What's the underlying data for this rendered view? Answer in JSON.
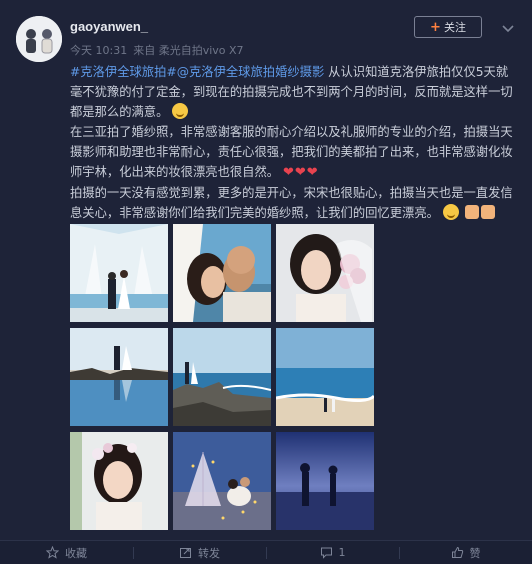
{
  "header": {
    "username": "gaoyanwen_",
    "time": "今天 10:31",
    "source": "来自 柔光自拍vivo X7",
    "follow_label": "关注"
  },
  "post": {
    "topic1": "#克洛伊全球旅拍#",
    "topic2": "@克洛伊全球旅拍婚纱摄影",
    "line1": " 从认识知道克洛伊旅拍仅仅5天就毫不犹豫的付了定金，到现在的拍摄完成也不到两个月的时间，反而就是这样一切都是那么的满意。",
    "line2": "在三亚拍了婚纱照，非常感谢客服的耐心介绍以及礼服师的专业的介绍，拍摄当天摄影师和助理也非常耐心，责任心很强，把我们的美都拍了出来，也非常感谢化妆师宇林，化出来的妆很漂亮也很自然。",
    "hearts": "❤❤❤",
    "line3": "拍摄的一天没有感觉到累，更多的是开心，宋宋也很贴心，拍摄当天也是一直发信息关心，非常感谢你们给我们完美的婚纱照，让我们的回忆更漂亮。"
  },
  "photos": [
    {
      "name": "photo-chapel-couple"
    },
    {
      "name": "photo-kiss-closeup"
    },
    {
      "name": "photo-bride-portrait"
    },
    {
      "name": "photo-reflection-pool"
    },
    {
      "name": "photo-rock-shore"
    },
    {
      "name": "photo-beach-walk"
    },
    {
      "name": "photo-bride-flowers"
    },
    {
      "name": "photo-tent-night"
    },
    {
      "name": "photo-silhouette-dusk"
    }
  ],
  "footer": {
    "favorite_label": "收藏",
    "repost_label": "转发",
    "comment_count": "1",
    "like_label": "赞"
  },
  "colors": {
    "background": "#1e2338",
    "topic_link": "#5f9ae8",
    "follow_plus": "#ff8140"
  }
}
